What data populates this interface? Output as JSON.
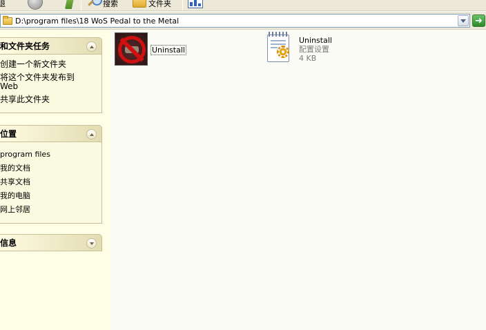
{
  "toolbar": {
    "back_label": "退",
    "search_label": "搜索",
    "folders_label": "文件夹"
  },
  "address": {
    "path": "D:\\program files\\18 WoS Pedal to the Metal"
  },
  "taskpane": {
    "tasks": {
      "title": "和文件夹任务",
      "items": [
        "创建一个新文件夹",
        "将这个文件夹发布到 Web",
        "共享此文件夹"
      ]
    },
    "places": {
      "title": "位置",
      "items": [
        "program files",
        "我的文档",
        "共享文档",
        "我的电脑",
        "网上邻居"
      ]
    },
    "details": {
      "title": "信息"
    }
  },
  "files": [
    {
      "name": "Uninstall",
      "type": "application",
      "icon": "no-entry-car-icon"
    },
    {
      "name": "Uninstall",
      "type": "配置设置",
      "size": "4 KB",
      "icon": "config-settings-icon"
    }
  ],
  "colors": {
    "taskpane_bg": "#fefee6",
    "header_grad_end": "#e3dcb2",
    "go_green": "#2b8a2a"
  }
}
